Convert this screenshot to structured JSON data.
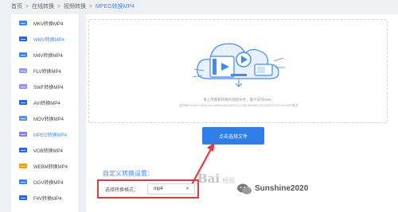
{
  "breadcrumb": {
    "home": "首页",
    "sep": ">",
    "level1": "在线转换",
    "level2": "视频转换",
    "current": "MPEG转换MP4"
  },
  "sidebar": {
    "items": [
      {
        "label": "MKV转换MP4",
        "color": "#3b82f6",
        "active": false
      },
      {
        "label": "WMV转换MP4",
        "color": "#2563eb",
        "active": true
      },
      {
        "label": "M4V转换MP4",
        "color": "#3b82f6",
        "active": false
      },
      {
        "label": "FLV转换MP4",
        "color": "#8b9bff",
        "active": false
      },
      {
        "label": "SWF转换MP4",
        "color": "#9b8cff",
        "active": false
      },
      {
        "label": "AVI转换MP4",
        "color": "#2563eb",
        "active": false
      },
      {
        "label": "MOV转换MP4",
        "color": "#5b8def",
        "active": false
      },
      {
        "label": "MPEG转换MP4",
        "color": "#8b7cf6",
        "active": true
      },
      {
        "label": "VOB转换MP4",
        "color": "#2563eb",
        "active": false
      },
      {
        "label": "WEBM转换MP4",
        "color": "#f59e0b",
        "active": false
      },
      {
        "label": "OGV转换MP4",
        "color": "#3b82f6",
        "active": false
      },
      {
        "label": "F4V转换MP4",
        "color": "#2563eb",
        "active": false
      }
    ]
  },
  "upload": {
    "hint_line1": "请上传需要转换的视频文件，最大支持20M，",
    "hint_line2": "支持MP4,MKV,MOV,AVI,WMV,M4V,MPEG,VOB,WEBM,OGV,3GP,FLV,F4V,SWF格式",
    "button_label": "点击选择文件"
  },
  "settings": {
    "title": "自定义转换设置：",
    "format_label": "选择转换格式：",
    "format_value": "mp4"
  },
  "watermarks": {
    "baidu": "Bai",
    "baidu_suffix": "经验",
    "wechat_name": "Sunshine2020"
  },
  "colors": {
    "accent": "#3f8cf0",
    "button": "#2f7ee8",
    "highlight_box": "#e23b3b",
    "arrow": "#e23b3b"
  }
}
